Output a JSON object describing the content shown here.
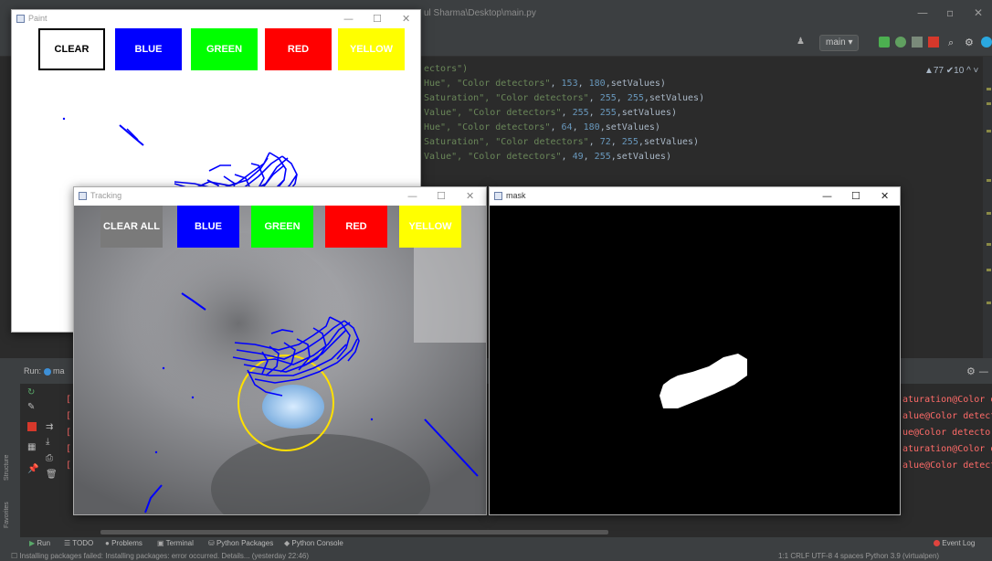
{
  "ide": {
    "title": "ul Sharma\\Desktop\\main.py",
    "branch": "main ▾",
    "inspections": "▲77 ✔10 ^ ˅",
    "code_lines": [
      {
        "text": "ectors\")",
        "kind": "plain"
      },
      {
        "pre": "Hue\", ",
        "str": "\"Color detectors\"",
        "mid": ", ",
        "n1": "153",
        "sep": ", ",
        "n2": "180",
        "post": ",setValues)"
      },
      {
        "pre": "Saturation\", ",
        "str": "\"Color detectors\"",
        "mid": ", ",
        "n1": "255",
        "sep": ", ",
        "n2": "255",
        "post": ",setValues)"
      },
      {
        "pre": "Value\", ",
        "str": "\"Color detectors\"",
        "mid": ", ",
        "n1": "255",
        "sep": ", ",
        "n2": "255",
        "post": ",setValues)"
      },
      {
        "pre": "Hue\", ",
        "str": "\"Color detectors\"",
        "mid": ", ",
        "n1": "64",
        "sep": ", ",
        "n2": "180",
        "post": ",setValues)"
      },
      {
        "pre": "Saturation\", ",
        "str": "\"Color detectors\"",
        "mid": ", ",
        "n1": "72",
        "sep": ", ",
        "n2": "255",
        "post": ",setValues)"
      },
      {
        "pre": "Value\", ",
        "str": "\"Color detectors\"",
        "mid": ", ",
        "n1": "49",
        "sep": ", ",
        "n2": "255",
        "post": ",setValues)"
      }
    ]
  },
  "run_panel": {
    "label": "Run:",
    "tab": "ma",
    "errors": [
      "aturation@Color de",
      "alue@Color detecto",
      "ue@Color detectors",
      "aturation@Color de",
      "alue@Color detecto"
    ],
    "bracket": "["
  },
  "tool_tabs": [
    "Run",
    "TODO",
    "Problems",
    "Terminal",
    "Python Packages",
    "Python Console"
  ],
  "event_log": "Event Log",
  "status": {
    "message": "Installing packages failed: Installing packages: error occurred. Details... (yesterday 22:46)",
    "right": "1:1  CRLF  UTF-8  4 spaces  Python 3.9 (virtualpen)"
  },
  "side_labels": [
    "Structure",
    "Favorites"
  ],
  "paint_window": {
    "title": "Paint",
    "buttons": [
      {
        "label": "CLEAR",
        "bg": "#ffffff",
        "fg": "#000000"
      },
      {
        "label": "BLUE",
        "bg": "#0000ff",
        "fg": "#ffffff"
      },
      {
        "label": "GREEN",
        "bg": "#00ff00",
        "fg": "#ffffff"
      },
      {
        "label": "RED",
        "bg": "#ff0000",
        "fg": "#ffffff"
      },
      {
        "label": "YELLOW",
        "bg": "#ffff00",
        "fg": "#ffffff"
      }
    ]
  },
  "tracking_window": {
    "title": "Tracking",
    "buttons": [
      {
        "label": "CLEAR ALL",
        "bg": "#7a7a7a",
        "fg": "#ffffff"
      },
      {
        "label": "BLUE",
        "bg": "#0000ff",
        "fg": "#ffffff"
      },
      {
        "label": "GREEN",
        "bg": "#00ff00",
        "fg": "#ffffff"
      },
      {
        "label": "RED",
        "bg": "#ff0000",
        "fg": "#ffffff"
      },
      {
        "label": "YELLOW",
        "bg": "#ffff00",
        "fg": "#ffffff"
      }
    ]
  },
  "mask_window": {
    "title": "mask"
  },
  "window_controls": {
    "minimize": "—",
    "maximize": "☐",
    "close": "✕"
  },
  "colors": {
    "stroke": "#0000ff",
    "circle": "#ffe000",
    "ide_bg": "#2b2b2b"
  }
}
